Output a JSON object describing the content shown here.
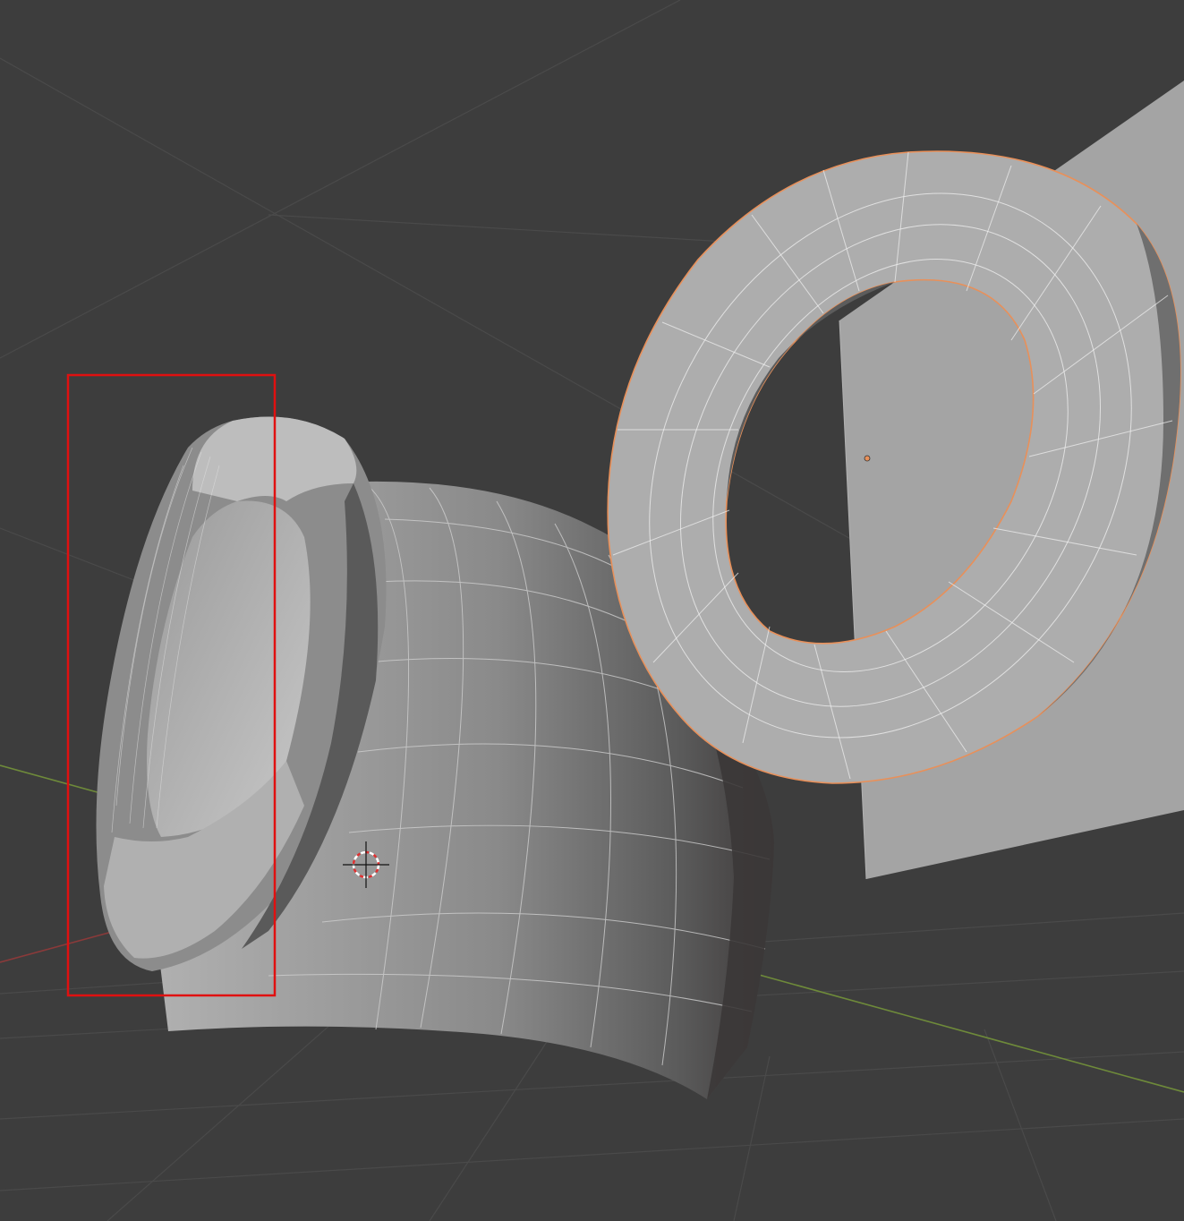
{
  "viewport": {
    "background": "#3d3d3d",
    "grid_color": "#4a4a4a",
    "x_axis_color": "#8a3a3a",
    "y_axis_color": "#6e8a3a",
    "selection_outline_color": "#e8905a",
    "annotation_box_color": "#e01010",
    "mesh_face_color": "#9a9a9a",
    "mesh_wire_color": "#d8d8d8"
  },
  "scene": {
    "objects": [
      {
        "name": "plane",
        "selected": false
      },
      {
        "name": "torus",
        "selected": true
      },
      {
        "name": "cylinder-segment",
        "selected": false
      },
      {
        "name": "ring",
        "selected": false
      }
    ],
    "cursor_icon": "3d-cursor-icon",
    "origin_icon": "object-origin-dot-icon"
  }
}
